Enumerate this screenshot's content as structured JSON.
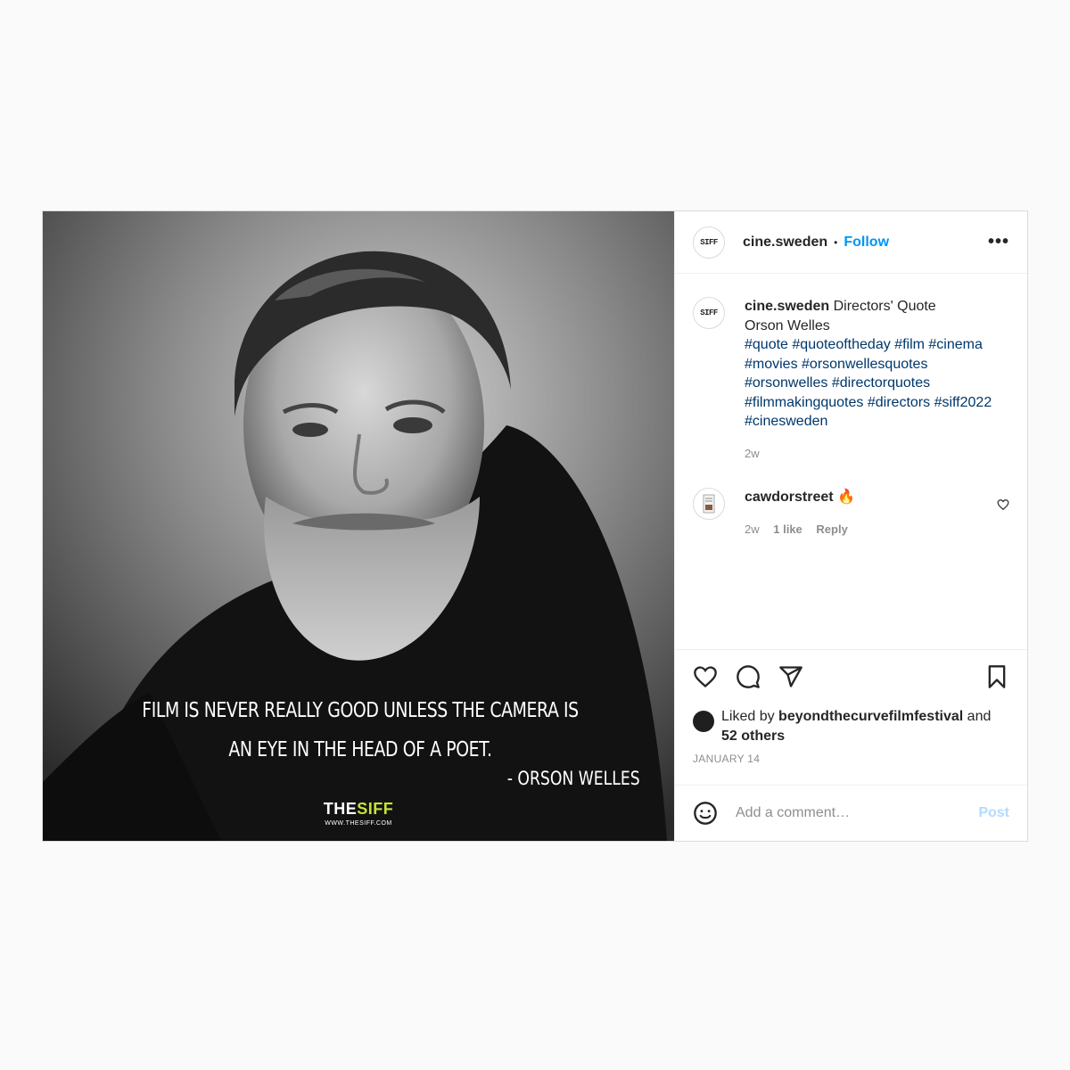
{
  "post": {
    "image": {
      "quote_line": "FILM IS NEVER REALLY GOOD UNLESS THE CAMERA IS AN EYE IN THE HEAD OF A POET.",
      "quote_author": "- ORSON WELLES",
      "brand_the": "THE",
      "brand_siff": "SIFF",
      "brand_url": "WWW.THESIFF.COM"
    },
    "header": {
      "avatar_text": "SIFF",
      "username": "cine.sweden",
      "separator": "•",
      "follow_label": "Follow",
      "more_label": "•••"
    },
    "caption": {
      "username": "cine.sweden",
      "line1": "Directors' Quote",
      "line2": "Orson Welles",
      "hashtags": [
        "#quote",
        "#quoteoftheday",
        "#film",
        "#cinema",
        "#movies",
        "#orsonwellesquotes",
        "#orsonwelles",
        "#directorquotes",
        "#filmmakingquotes",
        "#directors",
        "#siff2022",
        "#cinesweden"
      ],
      "time": "2w"
    },
    "comment": {
      "username": "cawdorstreet",
      "emoji": "🔥",
      "time": "2w",
      "likes": "1 like",
      "reply_label": "Reply"
    },
    "actions": {
      "liked_by_prefix": "Liked by",
      "liked_by_user": "beyondthecurvefilmfestival",
      "liked_by_and": "and",
      "others": "52 others",
      "date": "JANUARY 14"
    },
    "comment_box": {
      "placeholder": "Add a comment…",
      "post_label": "Post"
    }
  },
  "colors": {
    "link_blue": "#0095f6",
    "hashtag": "#00376b",
    "muted": "#8e8e8e",
    "post_disabled": "#b3dbff",
    "brand_accent": "#c6e23a"
  }
}
